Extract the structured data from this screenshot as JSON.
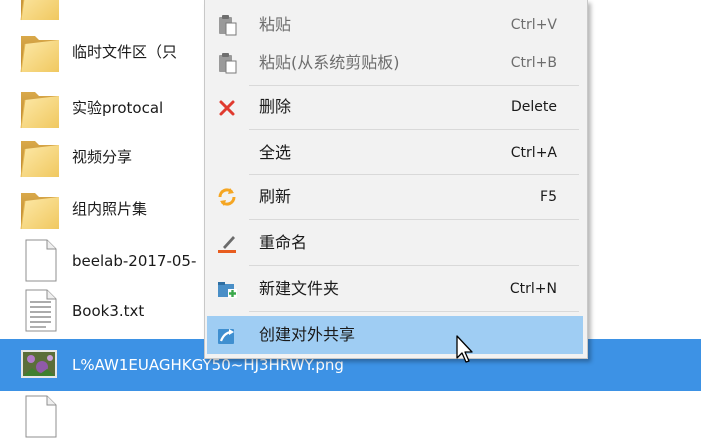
{
  "files": [
    {
      "name": "",
      "type": "folder"
    },
    {
      "name": "临时文件区（只",
      "type": "folder"
    },
    {
      "name": "实验protocal",
      "type": "folder"
    },
    {
      "name": "视频分享",
      "type": "folder"
    },
    {
      "name": "组内照片集",
      "type": "folder"
    },
    {
      "name": "beelab-2017-05-",
      "type": "file"
    },
    {
      "name": "Book3.txt",
      "type": "text-file"
    },
    {
      "name": "L%AW1EUAGHKGY50~HJ3HRWY.png",
      "type": "image",
      "selected": true
    }
  ],
  "context_menu": {
    "items": [
      {
        "label": "粘贴",
        "shortcut": "Ctrl+V",
        "icon": "paste-icon",
        "disabled": true
      },
      {
        "label": "粘贴(从系统剪贴板)",
        "shortcut": "Ctrl+B",
        "icon": "paste-icon",
        "disabled": true
      },
      {
        "label": "删除",
        "shortcut": "Delete",
        "icon": "delete-icon"
      },
      {
        "label": "全选",
        "shortcut": "Ctrl+A",
        "icon": ""
      },
      {
        "label": "刷新",
        "shortcut": "F5",
        "icon": "refresh-icon"
      },
      {
        "label": "重命名",
        "shortcut": "",
        "icon": "rename-icon"
      },
      {
        "label": "新建文件夹",
        "shortcut": "Ctrl+N",
        "icon": "new-folder-icon"
      },
      {
        "label": "创建对外共享",
        "shortcut": "",
        "icon": "share-icon",
        "hovered": true
      }
    ]
  },
  "colors": {
    "selection": "#3d92e5",
    "menu_hover": "#9fcdf3",
    "menu_background": "#f2f2f2",
    "delete_red": "#e03a2f",
    "refresh_orange": "#f5a623"
  }
}
